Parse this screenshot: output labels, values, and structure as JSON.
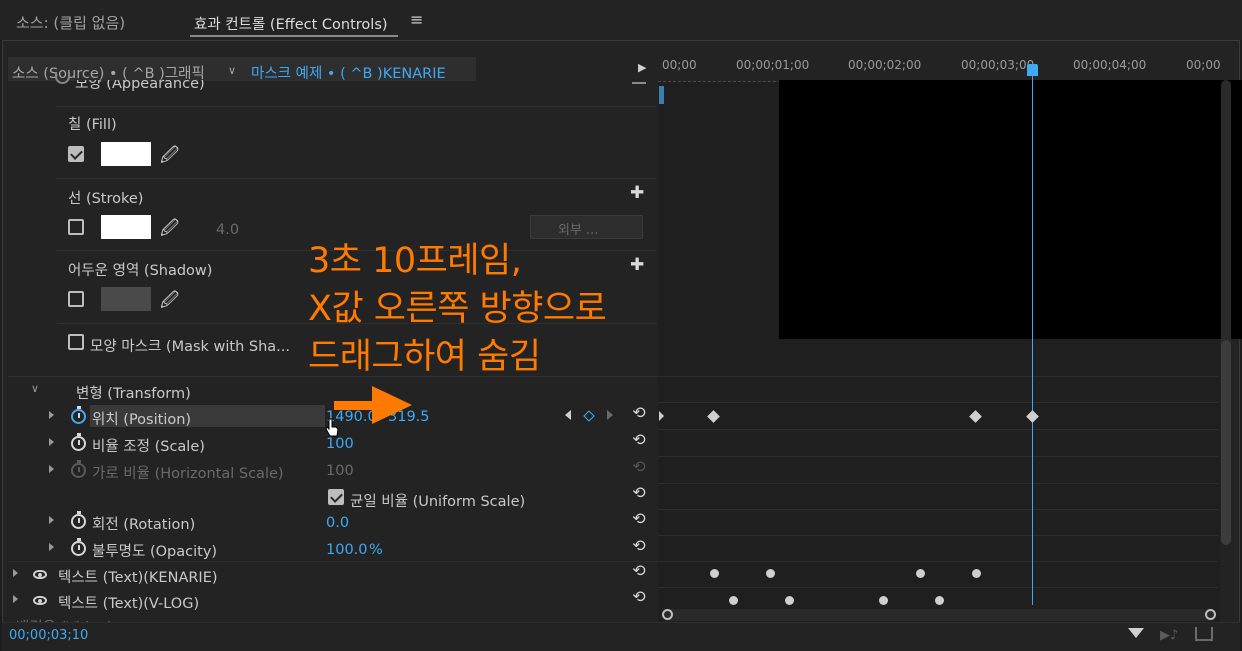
{
  "tabs": {
    "source": "소스: (클립 없음)",
    "effect_controls": "효과 컨트롤 (Effect Controls)",
    "menu_glyph": "≡"
  },
  "header": {
    "source_label": "소스 (Source) • ( ^B )그래픽",
    "sequence_label": "마스크 예제 • ( ^B )KENARIE",
    "play_glyph": "▶"
  },
  "timeline": {
    "ticks": [
      "00;00",
      "00;00;01;00",
      "00;00;02;00",
      "00;00;03;00",
      "00;00;04;00",
      "00;00"
    ],
    "timecode": "00;00;03;10"
  },
  "appearance": {
    "label_partial": "모양 (Appearance)",
    "fill_label": "칠 (Fill)",
    "stroke_label": "선 (Stroke)",
    "stroke_width": "4.0",
    "stroke_position": "외부 ...",
    "shadow_label": "어두운 영역 (Shadow)",
    "mask_label": "모양 마스크 (Mask with Sha...",
    "plus_glyph": "✚",
    "eyedropper_glyph": "🖉"
  },
  "transform": {
    "label": "변형 (Transform)",
    "position_label": "위치 (Position)",
    "position_x": "1490.0",
    "position_y": "319.5",
    "scale_label": "비율 조정 (Scale)",
    "scale_value": "100",
    "hscale_label": "가로 비율 (Horizontal Scale)",
    "hscale_value": "100",
    "uniform_label": "균일 비율 (Uniform Scale)",
    "rotation_label": "회전 (Rotation)",
    "rotation_value": "0.0",
    "opacity_label": "불투명도 (Opacity)",
    "opacity_value": "100.0",
    "opacity_unit": "%",
    "reset_glyph": "⟲"
  },
  "layers": {
    "text1": "텍스트 (Text)(KENARIE)",
    "text2": "텍스트 (Text)(V-LOG)",
    "partial": "배경은 (Video)"
  },
  "overlay": {
    "line1": "3초 10프레임,",
    "line2": "X값 오른쪽 방향으로",
    "line3": "드래그하여 숨김"
  },
  "colors": {
    "accent": "#3fa9f5",
    "overlay": "#ff7a00",
    "arrow": "#ff7a00"
  }
}
